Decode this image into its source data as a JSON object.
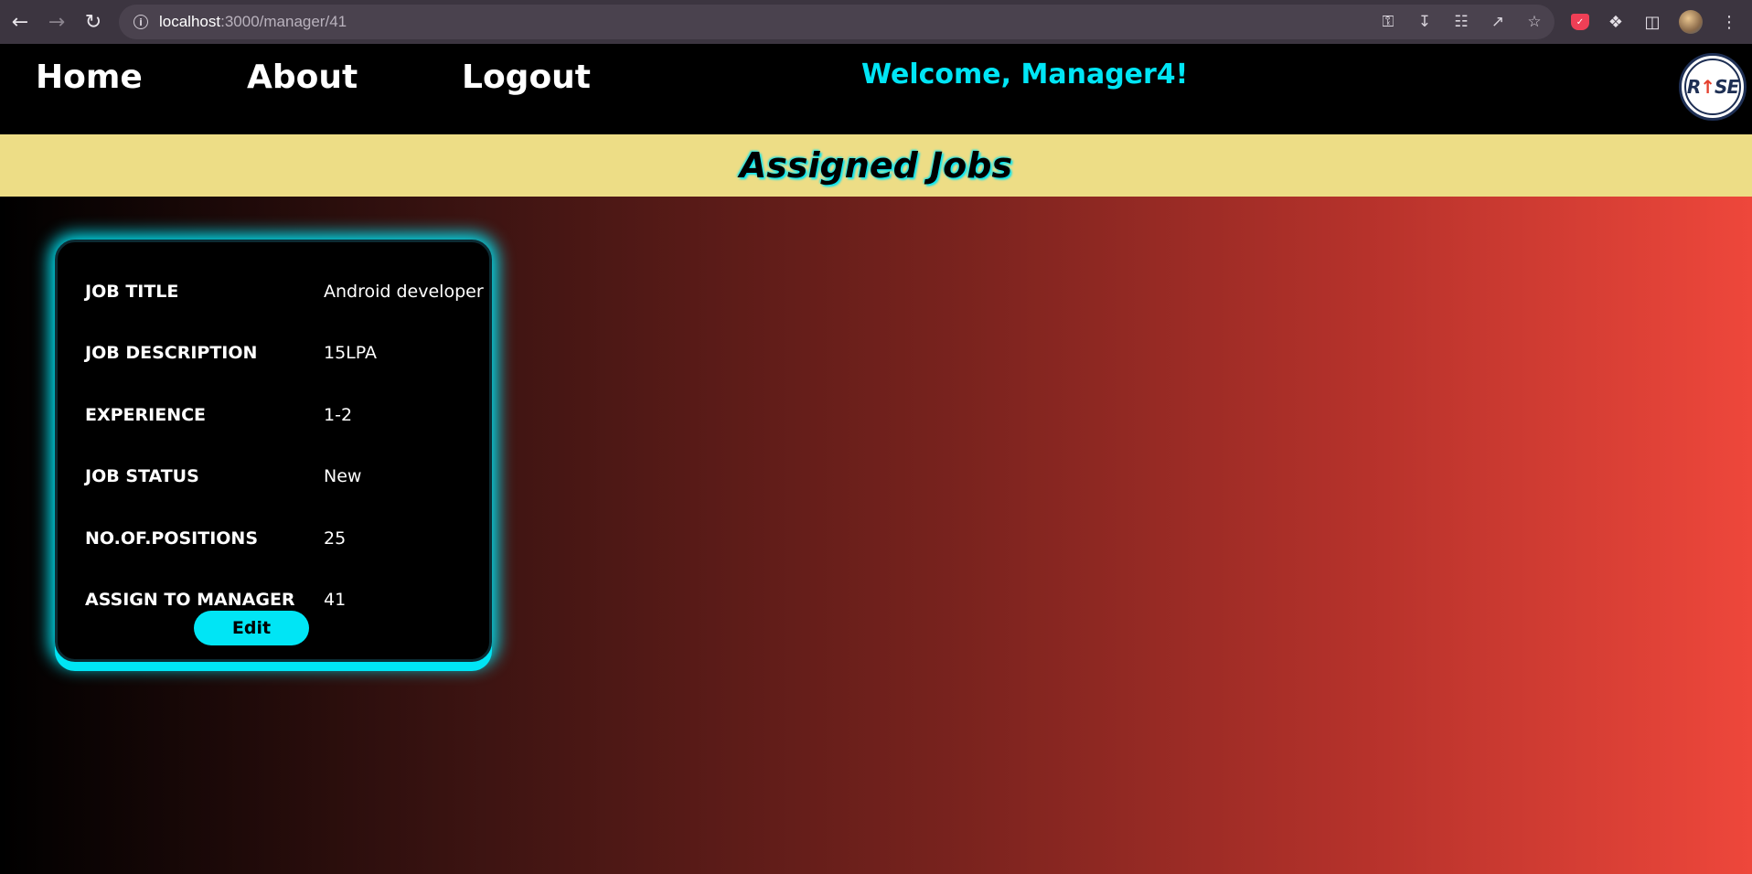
{
  "browser": {
    "url_host": "localhost",
    "url_path": ":3000/manager/41",
    "icons": [
      "back-icon",
      "forward-icon",
      "reload-icon",
      "info-icon",
      "key-icon",
      "install-icon",
      "translate-icon",
      "share-icon",
      "star-icon",
      "pocket-icon",
      "extensions-icon",
      "side-panel-icon",
      "profile-avatar",
      "menu-icon"
    ]
  },
  "header": {
    "nav": [
      "Home",
      "About",
      "Logout"
    ],
    "welcome": "Welcome, Manager4!",
    "logo_text": "RISE"
  },
  "banner": {
    "title": "Assigned Jobs"
  },
  "job_card": {
    "rows": [
      {
        "label": "JOB TITLE",
        "value": "Android developer"
      },
      {
        "label": "JOB DESCRIPTION",
        "value": "15LPA"
      },
      {
        "label": "EXPERIENCE",
        "value": "1-2"
      },
      {
        "label": "JOB STATUS",
        "value": "New"
      },
      {
        "label": "NO.OF.POSITIONS",
        "value": "25"
      },
      {
        "label": "ASSIGN TO MANAGER",
        "value": "41"
      }
    ],
    "edit_label": "Edit"
  },
  "colors": {
    "accent": "#00e5f5",
    "banner": "#eddd86",
    "gradient_end": "#ee473b"
  }
}
